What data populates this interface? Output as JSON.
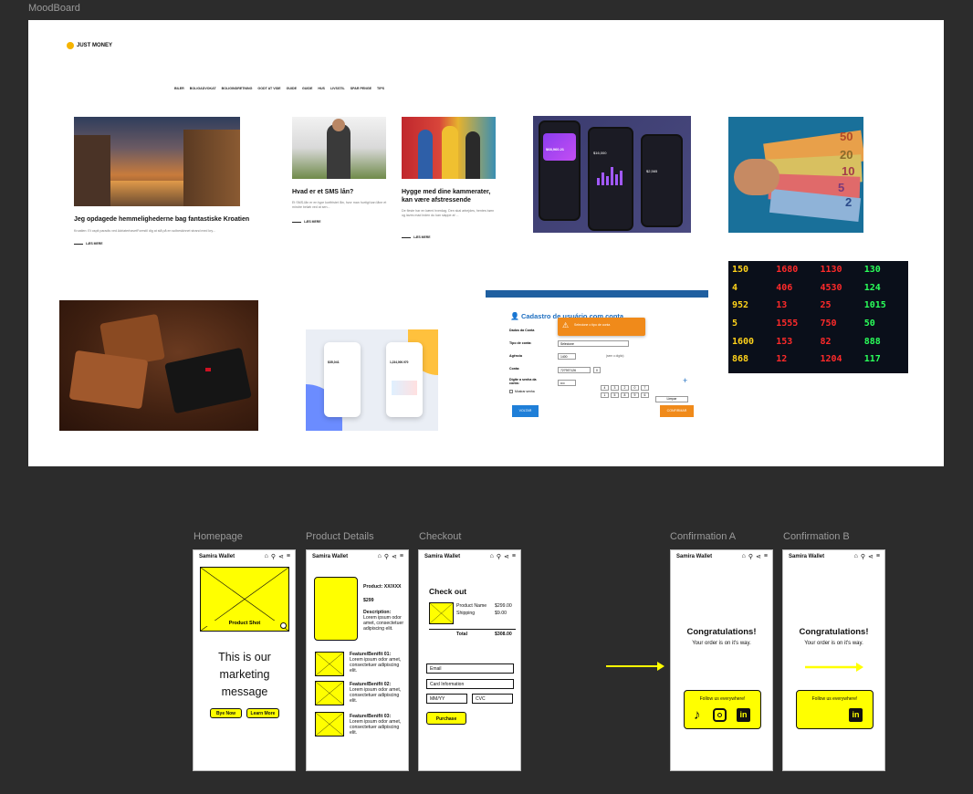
{
  "moodboard": {
    "label": "MoodBoard",
    "blog": {
      "logo": "JUST MONEY",
      "nav": [
        "BILER",
        "BOLIGADVOKAT",
        "BOLIGINDRETNING",
        "GODT AT VIDE",
        "GUIDE",
        "GUIDE",
        "HUS",
        "LIVSSTIL",
        "SPAR PENGE",
        "TIPS"
      ],
      "articles": [
        {
          "title": "Jeg opdagede hemmelighederne bag fantastiske Kroatien",
          "body": "Kroatien: Et ospit paradis ved AdriaterhavetForestil dig at stå på en solbeskinnet strand med kry...",
          "more": "LÆS MERE"
        },
        {
          "title": "Hvad er et SMS lån?",
          "body": "Et SMS-lån er en type kortfristet lån, hvor man hurtigt kan låne et mindre beløb ved at sen...",
          "more": "LÆS MERE"
        },
        {
          "title": "Hygge med dine kammerater, kan være afstressende",
          "body": "De fleste har en kæmi hverdag. Den skal arbejdes, hentes børn og laves mad inden du kan slappe af ...",
          "more": "LÆS MERE"
        }
      ]
    },
    "form": {
      "title": "Cadastro de usuário com conta",
      "alert": "Selecione o tipo de conta",
      "labels": [
        "Dados da Conta",
        "Tipo de conta:",
        "Agência",
        "Conta:",
        "Digite a senha da conta:",
        "Mostrar senha"
      ],
      "select": "Selecione",
      "agency": "1400",
      "agency_hint": "(sem o dígito)",
      "account": "727937126",
      "digit": "0",
      "password": "••••",
      "keys": [
        "4",
        "3",
        "2",
        "0",
        "7",
        "1",
        "5",
        "8",
        "9",
        "6"
      ],
      "clear": "Limpar",
      "back": "VOLTAR",
      "confirm": "CONFIRMAR"
    },
    "notes": {
      "currency": [
        "50",
        "20",
        "10",
        "5",
        "2"
      ],
      "ticker": [
        "150",
        "1680",
        "1130",
        "130",
        "4",
        "406",
        "4530",
        "124",
        "952",
        "13",
        "25",
        "1015",
        "5",
        "1555",
        "750",
        "50",
        "1600",
        "153",
        "82",
        "888",
        "868",
        "12",
        "1204",
        "117"
      ]
    },
    "apps": {
      "balance": "$68,960.21",
      "balance2": "$16,000",
      "balance3": "$2,565",
      "balance4": "$35,041",
      "balance5": "1,234,000.970"
    }
  },
  "wireframes": {
    "app_name": "Samira Wallet",
    "frames": [
      {
        "label": "Homepage"
      },
      {
        "label": "Product Details"
      },
      {
        "label": "Checkout"
      },
      {
        "label": "Confirmation A"
      },
      {
        "label": "Confirmation B"
      }
    ],
    "homepage": {
      "hero_label": "Product Shot",
      "message": "This is our marketing message",
      "buy_now": "Bye Now",
      "learn_more": "Learn More"
    },
    "product": {
      "product": "Product: XX/XXX",
      "price": "$299",
      "description_label": "Description:",
      "description": "Lorem ipsum odor amet, consectetuer adipiscing elit.",
      "features": [
        {
          "title": "Feature/Benifit 01:",
          "text": "Lorem ipsum odor amet, consectetuer adipiscing elit."
        },
        {
          "title": "Feature/Benifit 02:",
          "text": "Lorem ipsum odor amet, consectetuer adipiscing elit."
        },
        {
          "title": "Feature/Benifit 03:",
          "text": "Lorem ipsum odor amet, consectetuer adipiscing elit."
        }
      ]
    },
    "checkout": {
      "title": "Check out",
      "product_name": "Product Name",
      "product_price": "$299.00",
      "shipping": "Shipping",
      "shipping_price": "$9.00",
      "total": "Total",
      "total_price": "$308.00",
      "email": "Email",
      "card": "Card Information",
      "expiry": "MM/YY",
      "cvc": "CVC",
      "purchase": "Purchase"
    },
    "confirmation": {
      "title": "Congratulations!",
      "subtitle": "Your order is on it's way.",
      "follow": "Follow us everywhere!"
    }
  }
}
